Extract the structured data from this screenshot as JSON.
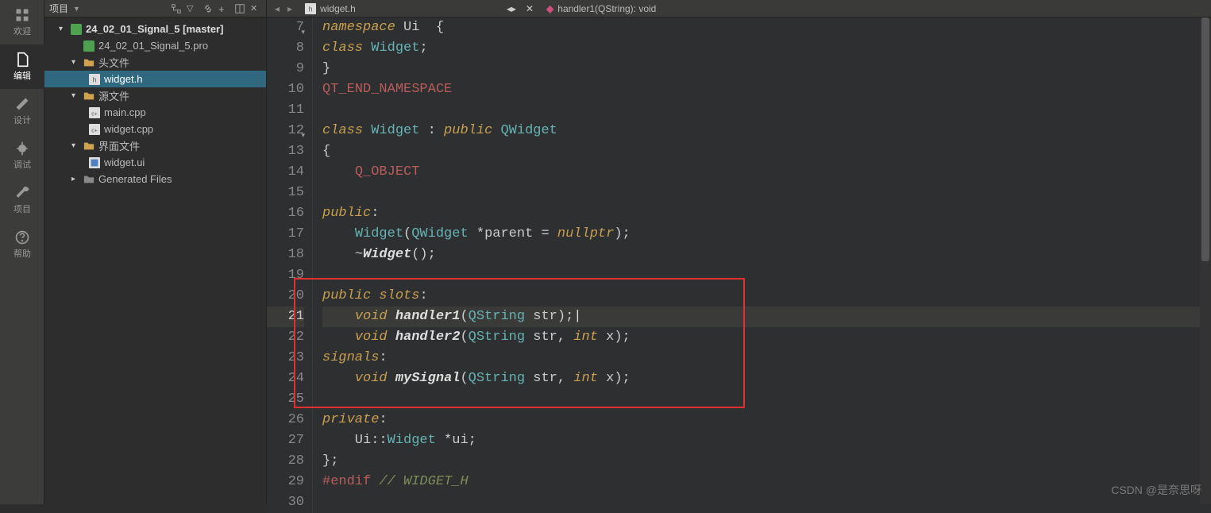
{
  "navrail": [
    {
      "label": "欢迎",
      "icon": "grid"
    },
    {
      "label": "编辑",
      "icon": "file",
      "active": true
    },
    {
      "label": "设计",
      "icon": "pencil"
    },
    {
      "label": "调试",
      "icon": "bug"
    },
    {
      "label": "项目",
      "icon": "wrench"
    },
    {
      "label": "帮助",
      "icon": "help"
    }
  ],
  "projectHeader": {
    "title": "项目",
    "icons": [
      "tree",
      "filter",
      "link",
      "plus",
      "split",
      "close"
    ]
  },
  "tree": {
    "root": {
      "label": "24_02_01_Signal_5 [master]"
    },
    "profile": {
      "label": "24_02_01_Signal_5.pro"
    },
    "headersFolder": {
      "label": "头文件"
    },
    "widgetH": {
      "label": "widget.h"
    },
    "sourcesFolder": {
      "label": "源文件"
    },
    "mainCpp": {
      "label": "main.cpp"
    },
    "widgetCpp": {
      "label": "widget.cpp"
    },
    "formsFolder": {
      "label": "界面文件"
    },
    "widgetUi": {
      "label": "widget.ui"
    },
    "genFiles": {
      "label": "Generated Files"
    }
  },
  "tabs": {
    "file": "widget.h",
    "crumb": "handler1(QString): void"
  },
  "code": {
    "startLine": 7,
    "lines": [
      {
        "n": 7,
        "fold": "-",
        "tokens": [
          [
            "kw",
            "namespace"
          ],
          [
            "norm",
            " Ui  "
          ],
          [
            "op",
            "{"
          ]
        ]
      },
      {
        "n": 8,
        "tokens": [
          [
            "kw",
            "class"
          ],
          [
            "norm",
            " "
          ],
          [
            "type",
            "Widget"
          ],
          [
            "op",
            ";"
          ]
        ]
      },
      {
        "n": 9,
        "tokens": [
          [
            "op",
            "}"
          ]
        ]
      },
      {
        "n": 10,
        "tokens": [
          [
            "macro",
            "QT_END_NAMESPACE"
          ]
        ]
      },
      {
        "n": 11,
        "tokens": []
      },
      {
        "n": 12,
        "fold": "-",
        "tokens": [
          [
            "kw",
            "class"
          ],
          [
            "norm",
            " "
          ],
          [
            "type",
            "Widget"
          ],
          [
            "norm",
            " "
          ],
          [
            "op",
            ":"
          ],
          [
            "norm",
            " "
          ],
          [
            "kw",
            "public"
          ],
          [
            "norm",
            " "
          ],
          [
            "type",
            "QWidget"
          ]
        ]
      },
      {
        "n": 13,
        "tokens": [
          [
            "op",
            "{"
          ]
        ]
      },
      {
        "n": 14,
        "tokens": [
          [
            "norm",
            "    "
          ],
          [
            "macro",
            "Q_OBJECT"
          ]
        ]
      },
      {
        "n": 15,
        "tokens": []
      },
      {
        "n": 16,
        "tokens": [
          [
            "kw",
            "public"
          ],
          [
            "op",
            ":"
          ]
        ]
      },
      {
        "n": 17,
        "tokens": [
          [
            "norm",
            "    "
          ],
          [
            "type",
            "Widget"
          ],
          [
            "op",
            "("
          ],
          [
            "type",
            "QWidget"
          ],
          [
            "norm",
            " "
          ],
          [
            "op",
            "*"
          ],
          [
            "norm",
            "parent "
          ],
          [
            "op",
            "="
          ],
          [
            "norm",
            " "
          ],
          [
            "null",
            "nullptr"
          ],
          [
            "op",
            ");"
          ]
        ]
      },
      {
        "n": 18,
        "tokens": [
          [
            "norm",
            "    "
          ],
          [
            "op",
            "~"
          ],
          [
            "func",
            "Widget"
          ],
          [
            "op",
            "();"
          ]
        ]
      },
      {
        "n": 19,
        "tokens": []
      },
      {
        "n": 20,
        "tokens": [
          [
            "kw",
            "public"
          ],
          [
            "norm",
            " "
          ],
          [
            "kw",
            "slots"
          ],
          [
            "op",
            ":"
          ]
        ]
      },
      {
        "n": 21,
        "current": true,
        "tokens": [
          [
            "norm",
            "    "
          ],
          [
            "kw",
            "void"
          ],
          [
            "norm",
            " "
          ],
          [
            "func",
            "handler1"
          ],
          [
            "op",
            "("
          ],
          [
            "type",
            "QString"
          ],
          [
            "norm",
            " str"
          ],
          [
            "op",
            ");"
          ],
          [
            "cursor",
            "|"
          ]
        ]
      },
      {
        "n": 22,
        "tokens": [
          [
            "norm",
            "    "
          ],
          [
            "kw",
            "void"
          ],
          [
            "norm",
            " "
          ],
          [
            "func",
            "handler2"
          ],
          [
            "op",
            "("
          ],
          [
            "type",
            "QString"
          ],
          [
            "norm",
            " str"
          ],
          [
            "op",
            ","
          ],
          [
            "norm",
            " "
          ],
          [
            "kw",
            "int"
          ],
          [
            "norm",
            " x"
          ],
          [
            "op",
            ");"
          ]
        ]
      },
      {
        "n": 23,
        "tokens": [
          [
            "kw",
            "signals"
          ],
          [
            "op",
            ":"
          ]
        ]
      },
      {
        "n": 24,
        "tokens": [
          [
            "norm",
            "    "
          ],
          [
            "kw",
            "void"
          ],
          [
            "norm",
            " "
          ],
          [
            "func",
            "mySignal"
          ],
          [
            "op",
            "("
          ],
          [
            "type",
            "QString"
          ],
          [
            "norm",
            " str"
          ],
          [
            "op",
            ","
          ],
          [
            "norm",
            " "
          ],
          [
            "kw",
            "int"
          ],
          [
            "norm",
            " x"
          ],
          [
            "op",
            ");"
          ]
        ]
      },
      {
        "n": 25,
        "tokens": []
      },
      {
        "n": 26,
        "tokens": [
          [
            "kw",
            "private"
          ],
          [
            "op",
            ":"
          ]
        ]
      },
      {
        "n": 27,
        "tokens": [
          [
            "norm",
            "    Ui"
          ],
          [
            "op",
            "::"
          ],
          [
            "type",
            "Widget"
          ],
          [
            "norm",
            " "
          ],
          [
            "op",
            "*"
          ],
          [
            "norm",
            "ui"
          ],
          [
            "op",
            ";"
          ]
        ]
      },
      {
        "n": 28,
        "tokens": [
          [
            "op",
            "};"
          ]
        ]
      },
      {
        "n": 29,
        "tokens": [
          [
            "pre",
            "#endif"
          ],
          [
            "norm",
            " "
          ],
          [
            "cmt",
            "// WIDGET_H"
          ]
        ]
      },
      {
        "n": 30,
        "tokens": []
      }
    ],
    "highlightBox": {
      "topLine": 19,
      "bottomLine": 25
    }
  },
  "watermark": "CSDN @是奈思呀"
}
